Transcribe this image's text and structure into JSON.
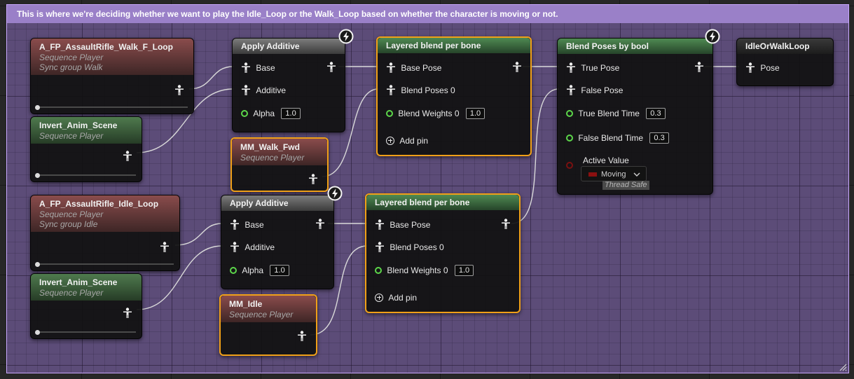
{
  "comment": {
    "text": "This is where we're deciding whether we want to play the Idle_Loop or the Walk_Loop based on whether the character is moving or not."
  },
  "nodes": {
    "walk_seq": {
      "title": "A_FP_AssaultRifle_Walk_F_Loop",
      "type": "Sequence Player",
      "sync": "Sync group Walk"
    },
    "invert_top": {
      "title": "Invert_Anim_Scene",
      "type": "Sequence Player"
    },
    "idle_seq": {
      "title": "A_FP_AssaultRifle_Idle_Loop",
      "type": "Sequence Player",
      "sync": "Sync group Idle"
    },
    "invert_bottom": {
      "title": "Invert_Anim_Scene",
      "type": "Sequence Player"
    },
    "additive_top": {
      "title": "Apply Additive",
      "base": "Base",
      "additive": "Additive",
      "alpha": "Alpha",
      "alpha_value": "1.0"
    },
    "additive_bottom": {
      "title": "Apply Additive",
      "base": "Base",
      "additive": "Additive",
      "alpha": "Alpha",
      "alpha_value": "1.0"
    },
    "mm_walk": {
      "title": "MM_Walk_Fwd",
      "type": "Sequence Player"
    },
    "mm_idle": {
      "title": "MM_Idle",
      "type": "Sequence Player"
    },
    "layered_top": {
      "title": "Layered blend per bone",
      "base_pose": "Base Pose",
      "blend_poses": "Blend Poses 0",
      "blend_weights": "Blend Weights 0",
      "weight_value": "1.0",
      "add_pin": "Add pin"
    },
    "layered_bottom": {
      "title": "Layered blend per bone",
      "base_pose": "Base Pose",
      "blend_poses": "Blend Poses 0",
      "blend_weights": "Blend Weights 0",
      "weight_value": "1.0",
      "add_pin": "Add pin"
    },
    "blend_bool": {
      "title": "Blend Poses by bool",
      "true_pose": "True Pose",
      "false_pose": "False Pose",
      "true_blend_time": "True Blend Time",
      "true_blend_value": "0.3",
      "false_blend_time": "False Blend Time",
      "false_blend_value": "0.3",
      "active_value": "Active Value",
      "active_selected": "Moving",
      "thread_safe": "Thread Safe"
    },
    "output": {
      "title": "IdleOrWalkLoop",
      "pose": "Pose"
    }
  },
  "colors": {
    "comment_bg": "#5c4c78",
    "comment_title": "#9a80c8",
    "selected_border": "#f0a018",
    "float_pin": "#5cd64a",
    "bool_pin": "#7a1010"
  }
}
